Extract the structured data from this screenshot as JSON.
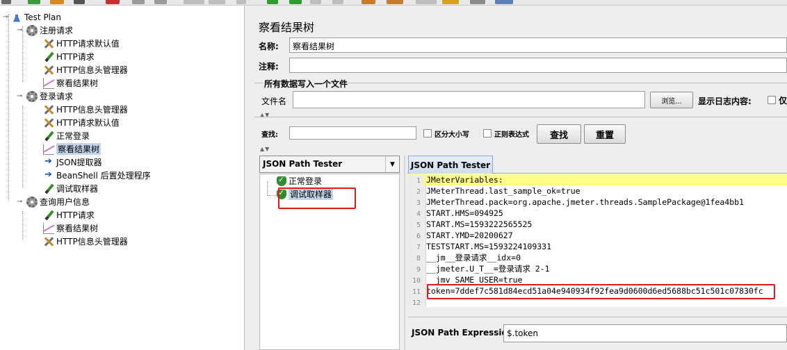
{
  "tree": {
    "root": "Test Plan",
    "items": [
      {
        "label": "注册请求",
        "icon": "gear-icon",
        "level": 1
      },
      {
        "label": "HTTP请求默认值",
        "icon": "wrench-icon",
        "level": 2
      },
      {
        "label": "HTTP请求",
        "icon": "pencil-icon",
        "level": 2
      },
      {
        "label": "HTTP信息头管理器",
        "icon": "wrench-icon",
        "level": 2
      },
      {
        "label": "察看结果树",
        "icon": "chart-icon",
        "level": 2
      },
      {
        "label": "登录请求",
        "icon": "gear-icon",
        "level": 1
      },
      {
        "label": "HTTP信息头管理器",
        "icon": "wrench-icon",
        "level": 2
      },
      {
        "label": "HTTP请求默认值",
        "icon": "wrench-icon",
        "level": 2
      },
      {
        "label": "正常登录",
        "icon": "pencil-icon",
        "level": 2
      },
      {
        "label": "察看结果树",
        "icon": "chart-icon",
        "level": 2,
        "selected": true
      },
      {
        "label": "JSON提取器",
        "icon": "extract-icon",
        "level": 2
      },
      {
        "label": "BeanShell 后置处理程序",
        "icon": "extract-icon",
        "level": 2
      },
      {
        "label": "调试取样器",
        "icon": "pencil-icon",
        "level": 2
      },
      {
        "label": "查询用户信息",
        "icon": "gear-icon",
        "level": 1
      },
      {
        "label": "HTTP请求",
        "icon": "pencil-icon",
        "level": 2
      },
      {
        "label": "察看结果树",
        "icon": "chart-icon",
        "level": 2
      },
      {
        "label": "HTTP信息头管理器",
        "icon": "wrench-icon",
        "level": 2
      }
    ]
  },
  "panel": {
    "title": "察看结果树",
    "name_label": "名称:",
    "name_value": "察看结果树",
    "comment_label": "注释:",
    "comment_value": "",
    "file_section_title": "所有数据写入一个文件",
    "file_label": "文件名",
    "file_value": "",
    "browse_button": "浏览...",
    "log_label": "显示日志内容:",
    "log_option": "仅"
  },
  "search": {
    "label": "查找:",
    "value": "",
    "case_label": "区分大小写",
    "regex_label": "正则表达式",
    "find_button": "查找",
    "reset_button": "重置"
  },
  "results": {
    "renderer": "JSON Path Tester",
    "samples": [
      "正常登录",
      "调试取样器"
    ],
    "selected_sample": "调试取样器",
    "tab_label": "JSON Path Tester",
    "lines": [
      "JMeterVariables:",
      "JMeterThread.last_sample_ok=true",
      "JMeterThread.pack=org.apache.jmeter.threads.SamplePackage@1fea4bb1",
      "START.HMS=094925",
      "START.MS=1593222565525",
      "START.YMD=20200627",
      "TESTSTART.MS=1593224109331",
      "__jm__登录请求__idx=0",
      "__jmeter.U_T__=登录请求 2-1",
      "__jmv_SAME_USER=true",
      "token=7ddef7c581d84ecd51a04e940934f92fea9d0600d6ed5688bc51c501c07830fc",
      ""
    ],
    "line_numbers": [
      "1",
      "2",
      "3",
      "4",
      "5",
      "6",
      "7",
      "8",
      "9",
      "10",
      "11",
      "12"
    ],
    "expression_label": "JSON Path Expression",
    "expression_value": "$.token"
  },
  "colors": {
    "highlight_annotation": "#e11b1b",
    "selection": "#c3d5ea",
    "line_highlight": "#ffff88"
  }
}
